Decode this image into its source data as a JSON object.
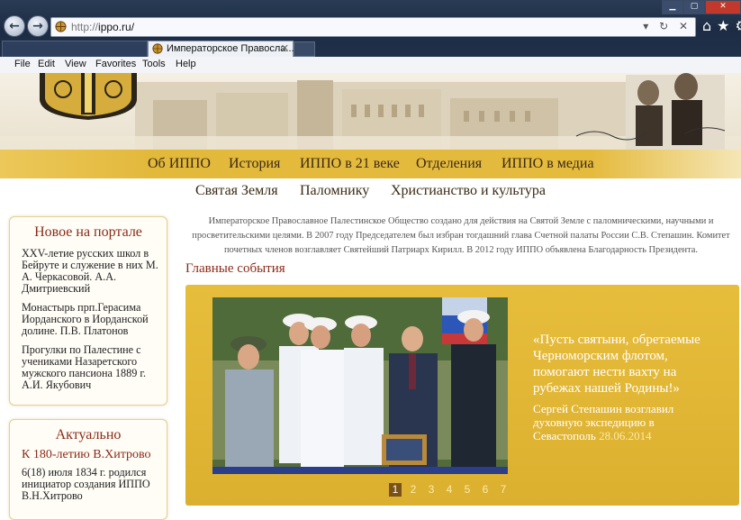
{
  "browser": {
    "url_prefix": "http://",
    "url_domain": "ippo.ru/",
    "tab_title": "Императорское Правосла...",
    "menu": [
      "File",
      "Edit",
      "View",
      "Favorites",
      "Tools",
      "Help"
    ]
  },
  "nav": {
    "top": [
      "Об ИППО",
      "История",
      "ИППО в 21 веке",
      "Отделения",
      "ИППО в медиа"
    ],
    "sub": [
      "Святая Земля",
      "Паломнику",
      "Христианство и культура"
    ]
  },
  "intro": "Императорское Православное Палестинское Общество создано для действия на Святой Земле с паломническими, научными и просветительскими целями. В 2007 году Председателем был избран тогдашний глава Счетной палаты России С.В. Степашин. Комитет почетных членов возглавляет Святейший Патриарх Кирилл. В 2012 году ИППО объявлена Благодарность Президента.",
  "main": {
    "section_title": "Главные события",
    "quote": "«Пусть святыни, обретаемые Черноморским флотом, помогают нести вахту на рубежах нашей Родины!»",
    "caption": "Сергей Степашин возглавил духовную экспедицию в Севастополь",
    "caption_date": "28.06.2014",
    "pages": [
      "1",
      "2",
      "3",
      "4",
      "5",
      "6",
      "7"
    ],
    "current_page": "1"
  },
  "sidebar": {
    "news_title": "Новое на портале",
    "news": [
      "XXV-летие русских школ в Бейруте и служение в них М. А. Черкасовой. А.А. Дмитриевский",
      "Монастырь прп.Герасима Иорданского в Иорданской долине. П.В. Платонов",
      "Прогулки по Палестине с учениками Назаретского мужского пансиона 1889 г. А.И. Якубович"
    ],
    "actual_title": "Актуально",
    "actual_headline": "К 180-летию В.Хитрово",
    "actual_text": "6(18) июля 1834 г. родился инициатор создания ИППО В.Н.Хитрово"
  },
  "colors": {
    "gold": "#e3b93c",
    "accent_red": "#8a2a18",
    "chrome": "#22334d"
  },
  "icons": [
    "back-icon",
    "forward-icon",
    "refresh-icon",
    "stop-icon",
    "home-icon",
    "star-icon",
    "gear-icon"
  ]
}
